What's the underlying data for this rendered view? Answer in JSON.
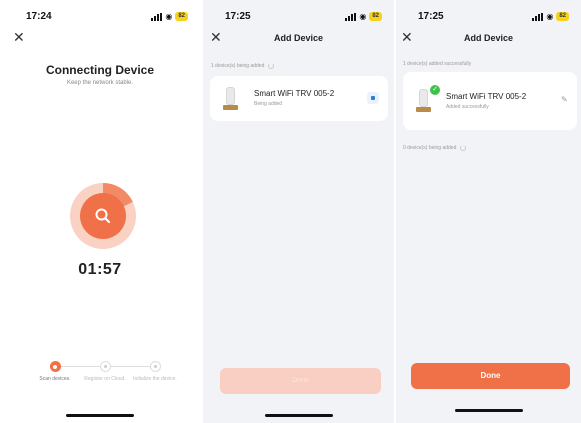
{
  "colors": {
    "accent": "#f07048",
    "success": "#3fc24b",
    "battery": "#f7d21c"
  },
  "screen1": {
    "time": "17:24",
    "battery": "82",
    "title": "Connecting Device",
    "subtitle": "Keep the network stable.",
    "timer": "01:57",
    "steps": [
      {
        "label": "Scan devices."
      },
      {
        "label": "Register on Cloud."
      },
      {
        "label": "Initialize the device."
      }
    ]
  },
  "screen2": {
    "time": "17:25",
    "battery": "82",
    "title": "Add Device",
    "section": "1 device(s) being added",
    "device_name": "Smart WiFi TRV 005-2",
    "device_status": "Being added",
    "button_label": "Done"
  },
  "screen3": {
    "time": "17:25",
    "battery": "82",
    "title": "Add Device",
    "section_success": "1 device(s) added successfully",
    "device_name": "Smart WiFi TRV 005-2",
    "device_status": "Added successfully",
    "section_pending": "0 device(s) being added",
    "button_label": "Done"
  }
}
